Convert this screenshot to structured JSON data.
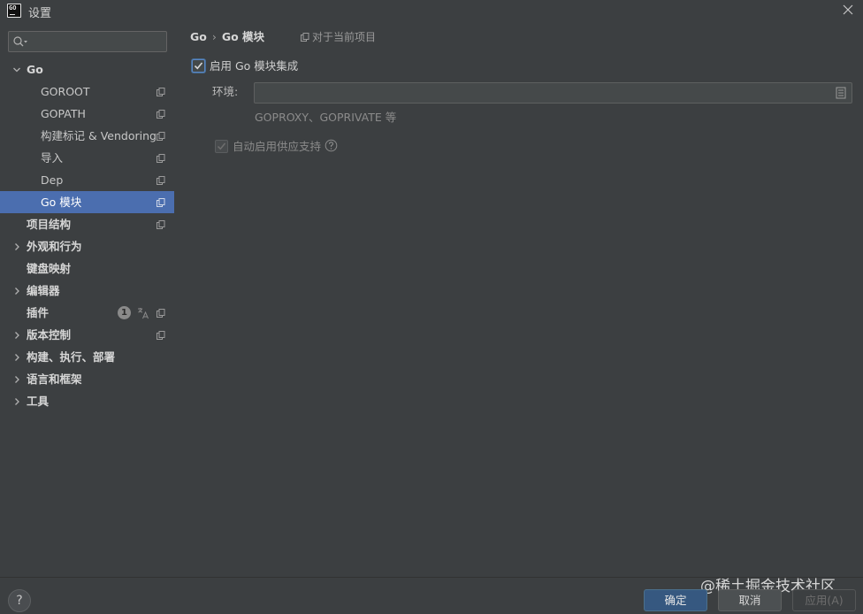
{
  "window": {
    "app_icon_text": "GO",
    "title": "设置"
  },
  "search": {
    "value": "",
    "placeholder": ""
  },
  "sidebar": {
    "items": [
      {
        "label": "Go",
        "expanded": true,
        "bold": true
      },
      {
        "label": "GOROOT"
      },
      {
        "label": "GOPATH"
      },
      {
        "label": "构建标记 & Vendoring"
      },
      {
        "label": "导入"
      },
      {
        "label": "Dep"
      },
      {
        "label": "Go 模块",
        "selected": true
      },
      {
        "label": "项目结构",
        "bold": true
      },
      {
        "label": "外观和行为",
        "bold": true,
        "expandable": true
      },
      {
        "label": "键盘映射",
        "bold": true
      },
      {
        "label": "编辑器",
        "bold": true,
        "expandable": true
      },
      {
        "label": "插件",
        "bold": true,
        "badge": "1"
      },
      {
        "label": "版本控制",
        "bold": true,
        "expandable": true
      },
      {
        "label": "构建、执行、部署",
        "bold": true,
        "expandable": true
      },
      {
        "label": "语言和框架",
        "bold": true,
        "expandable": true
      },
      {
        "label": "工具",
        "bold": true,
        "expandable": true
      }
    ]
  },
  "content": {
    "breadcrumb": [
      "Go",
      "Go 模块"
    ],
    "breadcrumb_separator": "›",
    "scope_label": "对于当前项目",
    "enable_checkbox": {
      "label": "启用 Go 模块集成",
      "checked": true
    },
    "env": {
      "label": "环境:",
      "value": "",
      "hint": "GOPROXY、GOPRIVATE 等"
    },
    "vendor_checkbox": {
      "label": "自动启用供应支持",
      "checked": true,
      "disabled": true
    }
  },
  "footer": {
    "help": "?",
    "ok": "确定",
    "cancel": "取消",
    "apply": "应用(A)",
    "watermark": "@稀土掘金技术社区"
  },
  "colors": {
    "background": "#3c3f41",
    "selection": "#4b6eaf",
    "primary_button": "#365880"
  }
}
